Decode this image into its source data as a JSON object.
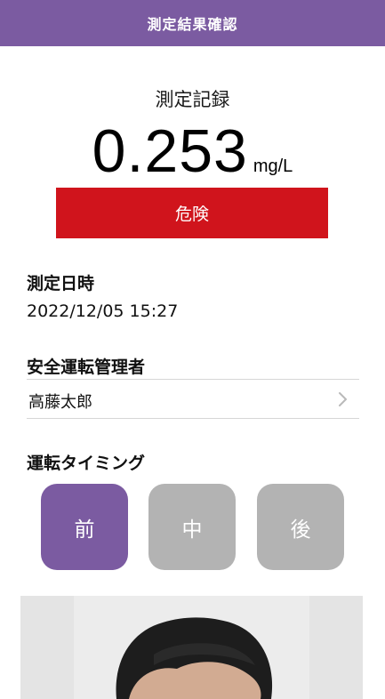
{
  "header": {
    "title": "測定結果確認"
  },
  "record": {
    "label": "測定記録",
    "value": "0.253",
    "unit": "mg/L",
    "status": "危険"
  },
  "measured_at": {
    "title": "測定日時",
    "value": "2022/12/05 15:27"
  },
  "manager": {
    "title": "安全運転管理者",
    "name": "高藤太郎"
  },
  "timing": {
    "title": "運転タイミング",
    "options": [
      {
        "label": "前",
        "selected": true
      },
      {
        "label": "中",
        "selected": false
      },
      {
        "label": "後",
        "selected": false
      }
    ]
  },
  "icons": {
    "manager_chevron": "chevron-right-icon"
  },
  "colors": {
    "accent": "#7b5ba1",
    "danger": "#d0141c",
    "inactive": "#b3b3b3"
  }
}
